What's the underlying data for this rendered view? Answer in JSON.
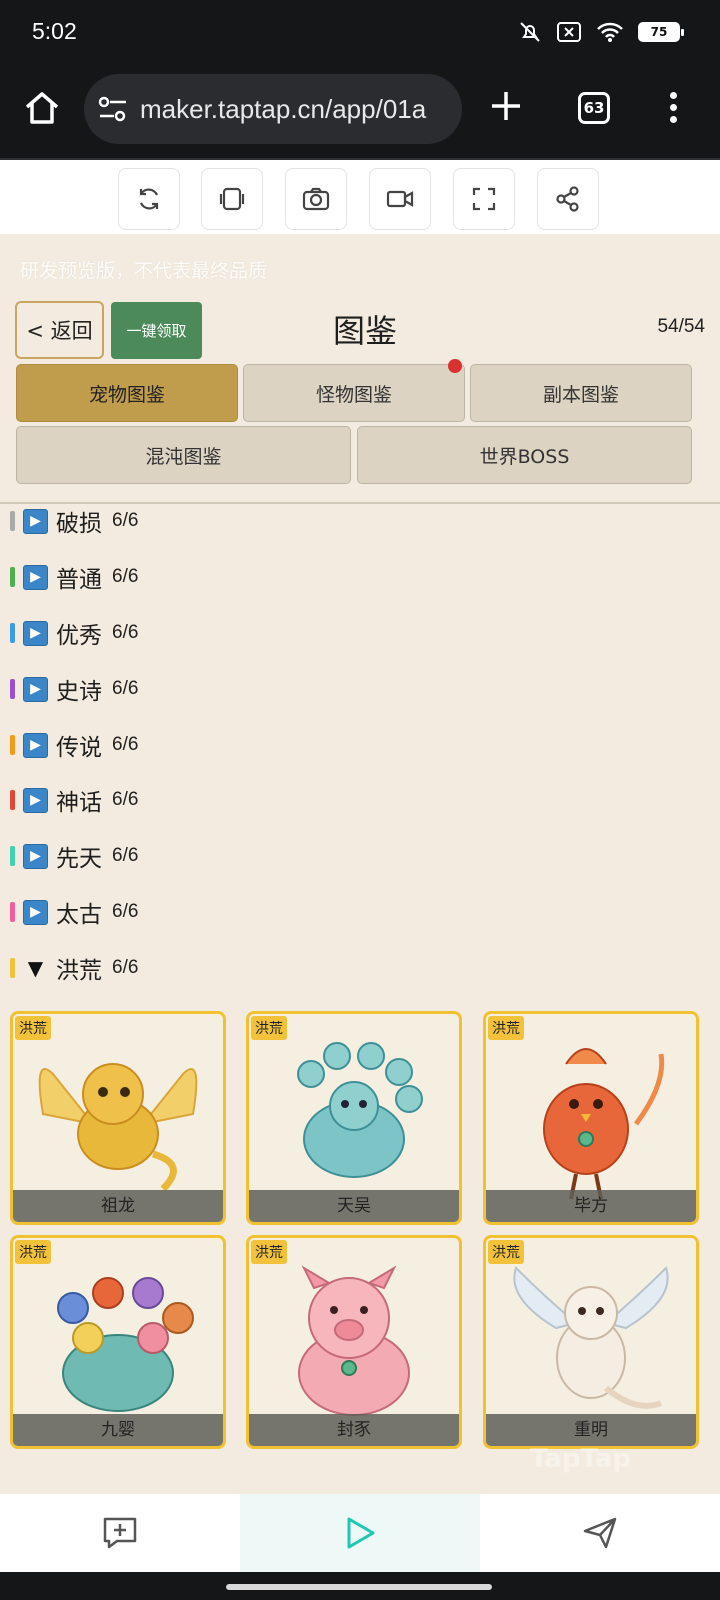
{
  "status_bar": {
    "time": "5:02",
    "battery": "75",
    "icons": [
      "bell-off-icon",
      "sim-off-icon",
      "wifi-icon",
      "battery-icon"
    ]
  },
  "browser": {
    "url": "maker.taptap.cn/app/01a",
    "tab_count": "63"
  },
  "toolbar": {
    "tools": [
      "refresh-icon",
      "rotate-icon",
      "screenshot-icon",
      "record-icon",
      "fullscreen-icon",
      "share-icon"
    ]
  },
  "game": {
    "watermark": "研发预览版，不代表最终品质",
    "back_label": "< 返回",
    "claim_label": "一键领取",
    "title": "图鉴",
    "count": "54/54",
    "tabs": [
      {
        "label": "宠物图鉴",
        "active": true
      },
      {
        "label": "怪物图鉴",
        "badge": true
      },
      {
        "label": "副本图鉴"
      },
      {
        "label": "混沌图鉴"
      },
      {
        "label": "世界BOSS"
      }
    ],
    "categories": [
      {
        "name": "破损",
        "count": "6/6",
        "color": "#a9a9a9",
        "expanded": false
      },
      {
        "name": "普通",
        "count": "6/6",
        "color": "#4caf50",
        "expanded": false
      },
      {
        "name": "优秀",
        "count": "6/6",
        "color": "#3f9be0",
        "expanded": false
      },
      {
        "name": "史诗",
        "count": "6/6",
        "color": "#9b4fc9",
        "expanded": false
      },
      {
        "name": "传说",
        "count": "6/6",
        "color": "#f29a1a",
        "expanded": false
      },
      {
        "name": "神话",
        "count": "6/6",
        "color": "#e0453b",
        "expanded": false
      },
      {
        "name": "先天",
        "count": "6/6",
        "color": "#3fd1b1",
        "expanded": false
      },
      {
        "name": "太古",
        "count": "6/6",
        "color": "#ef5fa0",
        "expanded": false
      },
      {
        "name": "洪荒",
        "count": "6/6",
        "color": "#f2c23a",
        "expanded": true
      }
    ],
    "pets": [
      {
        "tag": "洪荒",
        "name": "祖龙",
        "color": "#e8b83a"
      },
      {
        "tag": "洪荒",
        "name": "天吴",
        "color": "#6bbdc0"
      },
      {
        "tag": "洪荒",
        "name": "毕方",
        "color": "#e7673a"
      },
      {
        "tag": "洪荒",
        "name": "九婴",
        "color": "#6fbab2"
      },
      {
        "tag": "洪荒",
        "name": "封豕",
        "color": "#f2a0a8"
      },
      {
        "tag": "洪荒",
        "name": "重明",
        "color": "#efe2d3"
      }
    ]
  },
  "bottom_nav": [
    "comment-add-icon",
    "play-icon",
    "send-icon"
  ]
}
